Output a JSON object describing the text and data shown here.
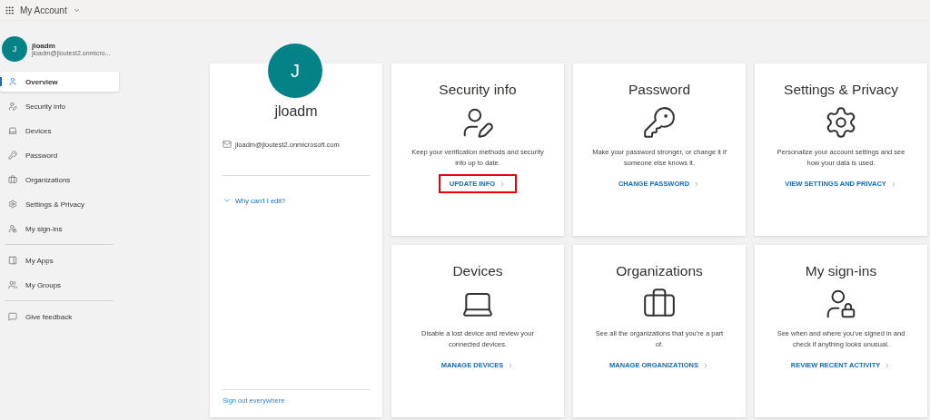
{
  "header": {
    "title": "My Account"
  },
  "user": {
    "initial": "J",
    "name": "jloadm",
    "email_short": "jloadm@jloutest2.onmicro..."
  },
  "sidebar": {
    "groups": [
      {
        "items": [
          {
            "label": "Overview",
            "selected": true
          },
          {
            "label": "Security info",
            "selected": false
          },
          {
            "label": "Devices",
            "selected": false
          },
          {
            "label": "Password",
            "selected": false
          },
          {
            "label": "Organizations",
            "selected": false
          },
          {
            "label": "Settings & Privacy",
            "selected": false
          },
          {
            "label": "My sign-ins",
            "selected": false
          }
        ]
      },
      {
        "items": [
          {
            "label": "My Apps",
            "selected": false
          },
          {
            "label": "My Groups",
            "selected": false
          }
        ]
      },
      {
        "items": [
          {
            "label": "Give feedback",
            "selected": false
          }
        ]
      }
    ]
  },
  "profile_card": {
    "initial": "J",
    "name": "jloadm",
    "email": "jloadm@jloutest2.onmicrosoft.com",
    "why_link": "Why can't I edit?",
    "sign_out": "Sign out everywhere"
  },
  "tiles": [
    {
      "title": "Security info",
      "description": "Keep your verification methods and security info up to date.",
      "link": "UPDATE INFO",
      "highlighted": true
    },
    {
      "title": "Password",
      "description": "Make your password stronger, or change it if someone else knows it.",
      "link": "CHANGE PASSWORD",
      "highlighted": false
    },
    {
      "title": "Settings & Privacy",
      "description": "Personalize your account settings and see how your data is used.",
      "link": "VIEW SETTINGS AND PRIVACY",
      "highlighted": false
    },
    {
      "title": "Devices",
      "description": "Disable a lost device and review your connected devices.",
      "link": "MANAGE DEVICES",
      "highlighted": false
    },
    {
      "title": "Organizations",
      "description": "See all the organizations that you're a part of.",
      "link": "MANAGE ORGANIZATIONS",
      "highlighted": false
    },
    {
      "title": "My sign-ins",
      "description": "See when and where you've signed in and check if anything looks unusual.",
      "link": "REVIEW RECENT ACTIVITY",
      "highlighted": false
    }
  ]
}
